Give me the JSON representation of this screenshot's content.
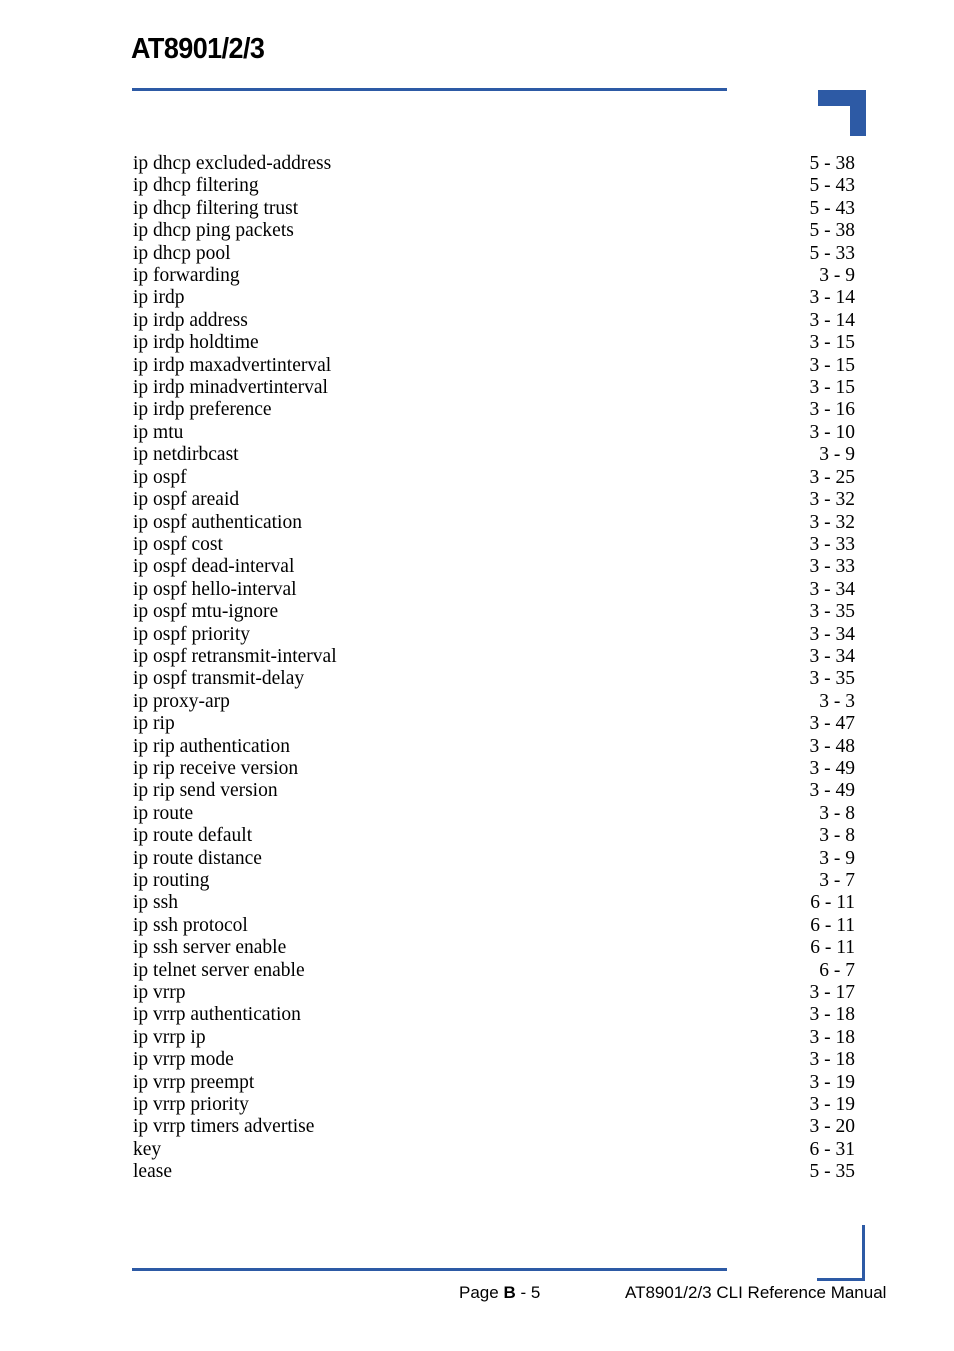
{
  "header": {
    "title": "AT8901/2/3",
    "rule_color": "#2d5aa5",
    "corner_marker": "corner-bracket"
  },
  "index": {
    "entries": [
      {
        "term": "ip dhcp excluded-address",
        "page": "5 - 38"
      },
      {
        "term": "ip dhcp filtering",
        "page": "5 - 43"
      },
      {
        "term": "ip dhcp filtering trust",
        "page": "5 - 43"
      },
      {
        "term": "ip dhcp ping packets",
        "page": "5 - 38"
      },
      {
        "term": "ip dhcp pool",
        "page": "5 - 33"
      },
      {
        "term": "ip forwarding",
        "page": "3 - 9"
      },
      {
        "term": "ip irdp",
        "page": "3 - 14"
      },
      {
        "term": "ip irdp address",
        "page": "3 - 14"
      },
      {
        "term": "ip irdp holdtime",
        "page": "3 - 15"
      },
      {
        "term": "ip irdp maxadvertinterval",
        "page": "3 - 15"
      },
      {
        "term": "ip irdp minadvertinterval",
        "page": "3 - 15"
      },
      {
        "term": "ip irdp preference",
        "page": "3 - 16"
      },
      {
        "term": "ip mtu",
        "page": "3 - 10"
      },
      {
        "term": "ip netdirbcast",
        "page": "3 - 9"
      },
      {
        "term": "ip ospf",
        "page": "3 - 25"
      },
      {
        "term": "ip ospf areaid",
        "page": "3 - 32"
      },
      {
        "term": "ip ospf authentication",
        "page": "3 - 32"
      },
      {
        "term": "ip ospf cost",
        "page": "3 - 33"
      },
      {
        "term": "ip ospf dead-interval",
        "page": "3 - 33"
      },
      {
        "term": "ip ospf hello-interval",
        "page": "3 - 34"
      },
      {
        "term": "ip ospf mtu-ignore",
        "page": "3 - 35"
      },
      {
        "term": "ip ospf priority",
        "page": "3 - 34"
      },
      {
        "term": "ip ospf retransmit-interval",
        "page": "3 - 34"
      },
      {
        "term": "ip ospf transmit-delay",
        "page": "3 - 35"
      },
      {
        "term": "ip proxy-arp",
        "page": "3 - 3"
      },
      {
        "term": "ip rip",
        "page": "3 - 47"
      },
      {
        "term": "ip rip authentication",
        "page": "3 - 48"
      },
      {
        "term": "ip rip receive version",
        "page": "3 - 49"
      },
      {
        "term": "ip rip send version",
        "page": "3 - 49"
      },
      {
        "term": "ip route",
        "page": "3 - 8"
      },
      {
        "term": "ip route default",
        "page": "3 - 8"
      },
      {
        "term": "ip route distance",
        "page": "3 - 9"
      },
      {
        "term": "ip routing",
        "page": "3 - 7"
      },
      {
        "term": "ip ssh",
        "page": "6 - 11"
      },
      {
        "term": "ip ssh protocol",
        "page": "6 - 11"
      },
      {
        "term": "ip ssh server enable",
        "page": "6 - 11"
      },
      {
        "term": "ip telnet server enable",
        "page": "6 - 7"
      },
      {
        "term": "ip vrrp",
        "page": "3 - 17"
      },
      {
        "term": "ip vrrp authentication",
        "page": "3 - 18"
      },
      {
        "term": "ip vrrp ip",
        "page": "3 - 18"
      },
      {
        "term": "ip vrrp mode",
        "page": "3 - 18"
      },
      {
        "term": "ip vrrp preempt",
        "page": "3 - 19"
      },
      {
        "term": "ip vrrp priority",
        "page": "3 - 19"
      },
      {
        "term": "ip vrrp timers advertise",
        "page": "3 - 20"
      },
      {
        "term": "key",
        "page": "6 - 31"
      },
      {
        "term": "lease",
        "page": "5 - 35"
      }
    ]
  },
  "footer": {
    "page_label_prefix": "Page ",
    "page_label_chapter": "B",
    "page_label_suffix": " - 5",
    "manual_title": "AT8901/2/3 CLI Reference Manual",
    "rule_color": "#2d5aa5"
  }
}
